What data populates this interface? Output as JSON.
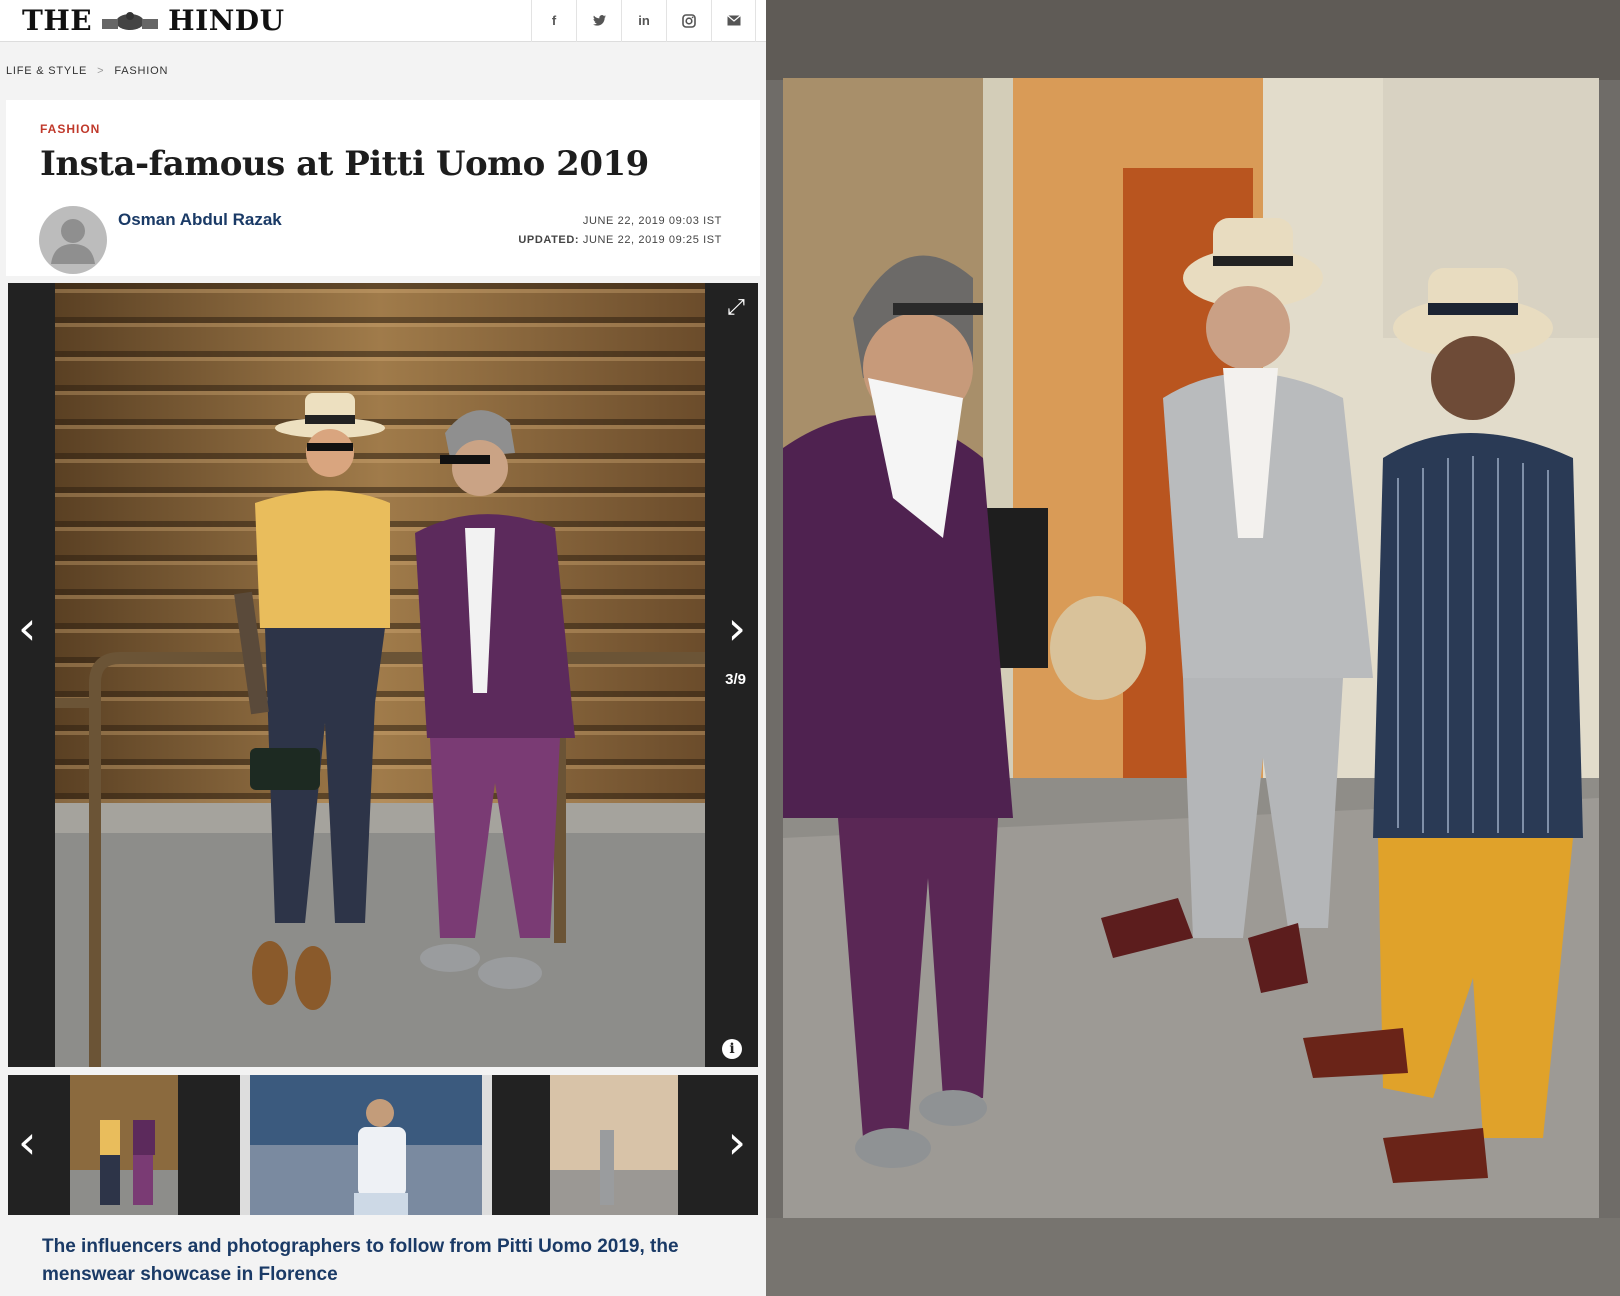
{
  "header": {
    "logo_left": "THE",
    "logo_right": "HINDU",
    "social": [
      {
        "icon": "facebook-icon",
        "glyph": "f"
      },
      {
        "icon": "twitter-icon",
        "glyph": "🐦"
      },
      {
        "icon": "linkedin-icon",
        "glyph": "in"
      },
      {
        "icon": "instagram-icon",
        "glyph": "◎"
      },
      {
        "icon": "email-icon",
        "glyph": "✉"
      }
    ]
  },
  "breadcrumb": {
    "items": [
      "LIFE & STYLE",
      "FASHION"
    ],
    "separator": ">"
  },
  "article": {
    "section": "FASHION",
    "title": "Insta-famous at Pitti Uomo 2019",
    "author": "Osman Abdul Razak",
    "published": "JUNE 22, 2019 09:03 IST",
    "updated_label": "UPDATED:",
    "updated": "JUNE 22, 2019 09:25 IST",
    "caption": "The influencers and photographers to follow from Pitti Uomo 2019, the menswear showcase in Florence"
  },
  "gallery": {
    "counter": "3/9",
    "prev_glyph": "‹",
    "next_glyph": "›",
    "info_glyph": "i",
    "expand_glyph": "⤢"
  },
  "colors": {
    "brand_blue": "#1a3a66",
    "section_red": "#c0392b"
  }
}
